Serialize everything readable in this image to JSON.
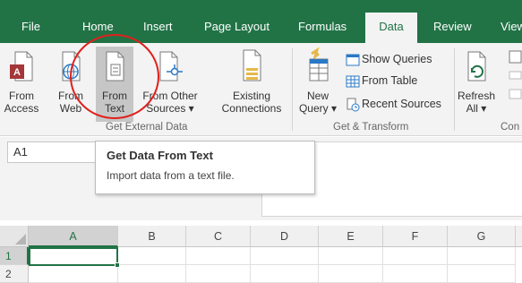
{
  "tabs": [
    {
      "label": "File"
    },
    {
      "label": "Home"
    },
    {
      "label": "Insert"
    },
    {
      "label": "Page Layout"
    },
    {
      "label": "Formulas"
    },
    {
      "label": "Data"
    },
    {
      "label": "Review"
    },
    {
      "label": "View"
    }
  ],
  "active_tab": "Data",
  "ribbon": {
    "get_external": {
      "group_label": "Get External Data",
      "from_access": {
        "line1": "From",
        "line2": "Access"
      },
      "from_web": {
        "line1": "From",
        "line2": "Web"
      },
      "from_text": {
        "line1": "From",
        "line2": "Text"
      },
      "from_other": {
        "line1": "From Other",
        "line2": "Sources ▾"
      },
      "existing": {
        "line1": "Existing",
        "line2": "Connections"
      }
    },
    "get_transform": {
      "group_label": "Get & Transform",
      "new_query": {
        "line1": "New",
        "line2": "Query ▾"
      },
      "show_queries": "Show Queries",
      "from_table": "From Table",
      "recent_sources": "Recent Sources"
    },
    "connections": {
      "group_label": "Con",
      "refresh": {
        "line1": "Refresh",
        "line2": "All ▾"
      }
    }
  },
  "name_box": "A1",
  "tooltip": {
    "title": "Get Data From Text",
    "body": "Import data from a text file."
  },
  "grid": {
    "columns": [
      "A",
      "B",
      "C",
      "D",
      "E",
      "F",
      "G"
    ],
    "rows": [
      "1",
      "2"
    ],
    "selected_cell": "A1"
  },
  "colors": {
    "accent": "#217346",
    "highlight_circle": "#e0201c"
  }
}
